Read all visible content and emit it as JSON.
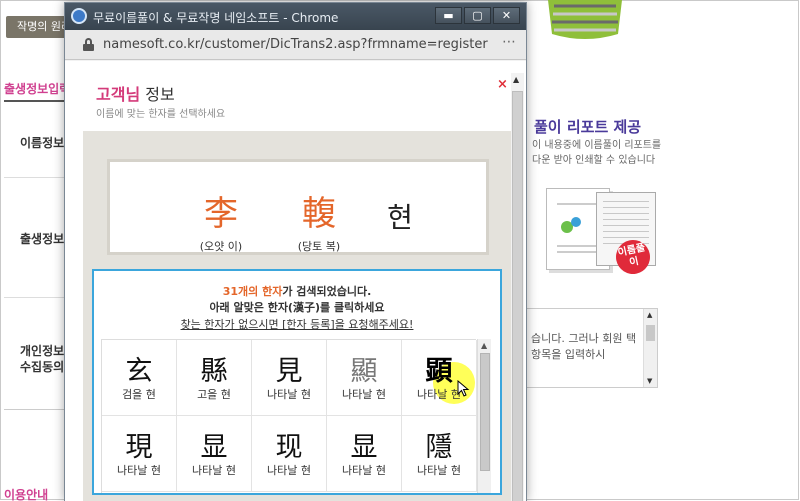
{
  "background": {
    "tab_label": "작명의 원리",
    "section_title": "출생정보입력",
    "form_rows": [
      "이름정보",
      "출생정보",
      "개인정보",
      "수집동의"
    ],
    "bottom_title": "이용안내",
    "report_title_a": "풀이",
    "report_title_b": "리포트 제공",
    "report_desc": "이 내용중에 이름풀이 리포트를 다운 받아 인쇄할 수 있습니다",
    "stamp_text": "이름풀이",
    "consent_text": "습니다. 그러나 회원 택항목을 입력하시"
  },
  "popup": {
    "window_title": "무료이름풀이 & 무료작명 네임소프트 - Chrome",
    "url": "namesoft.co.kr/customer/DicTrans2.asp?frmname=register",
    "header_title_accent": "고객님",
    "header_title_rest": " 정보",
    "header_sub": "이름에 맞는 한자를 선택하세요",
    "close_label": "×",
    "name_chars": [
      {
        "char": "李",
        "reading": "(오얏 이)"
      },
      {
        "char": "輹",
        "reading": "(당토 복)"
      },
      {
        "char": "현",
        "reading": ""
      }
    ],
    "result": {
      "count": "31개의",
      "hanja_word": "한자",
      "line1_rest": "가 검색되었습니다.",
      "line2": "아래 알맞은 한자(漢子)를 클릭하세요",
      "line3": "찾는 한자가 없으시면 [한자 등록]을 요청해주세요!"
    },
    "hanja_grid": [
      {
        "char": "玄",
        "meaning": "검을 현"
      },
      {
        "char": "縣",
        "meaning": "고을 현"
      },
      {
        "char": "見",
        "meaning": "나타날 현"
      },
      {
        "char": "顯",
        "meaning": "나타날 현"
      },
      {
        "char": "顕",
        "meaning": "나타날 현"
      },
      {
        "char": "現",
        "meaning": "나타날 현"
      },
      {
        "char": "显",
        "meaning": "나타날 현"
      },
      {
        "char": "现",
        "meaning": "나타날 현"
      },
      {
        "char": "显",
        "meaning": "나타날 현"
      },
      {
        "char": "隱",
        "meaning": "나타날 현"
      }
    ]
  },
  "colors": {
    "accent_pink": "#d43a7a",
    "accent_orange": "#e4662a",
    "result_border": "#3ba6dc"
  }
}
